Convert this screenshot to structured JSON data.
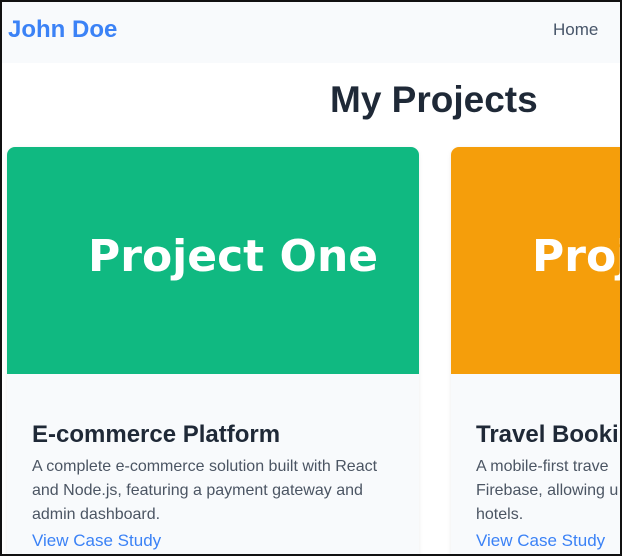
{
  "header": {
    "brand": "John Doe",
    "nav": {
      "home": "Home"
    }
  },
  "main": {
    "title": "My Projects",
    "projects": [
      {
        "media_label": "Project One",
        "media_color": "#10b981",
        "title": "E-commerce Platform",
        "description": "A complete e-commerce solution built with React and Node.js, featuring a payment gateway and admin dashboard.",
        "link": "View Case Study"
      },
      {
        "media_label": "Proje",
        "media_color": "#f59e0b",
        "title": "Travel Booki",
        "description": "A mobile-first trave Firebase, allowing u hotels.",
        "link": "View Case Study"
      }
    ]
  },
  "colors": {
    "accent": "#3b82f6",
    "text_dark": "#1f2937",
    "text_muted": "#4b5563",
    "header_bg": "#f8fafc"
  }
}
